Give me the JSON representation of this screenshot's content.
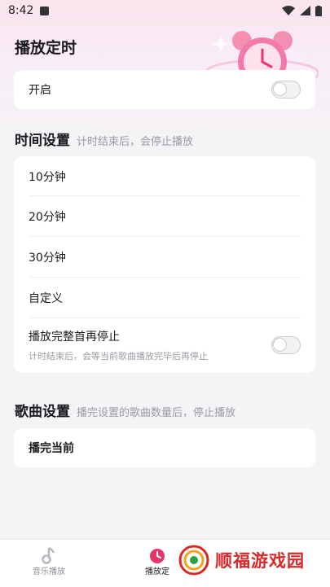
{
  "status_bar": {
    "time": "8:42"
  },
  "page_title": "播放定时",
  "enable": {
    "label": "开启"
  },
  "time_section": {
    "title": "时间设置",
    "subtitle": "计时结束后，会停止播放",
    "options": [
      "10分钟",
      "20分钟",
      "30分钟",
      "自定义"
    ],
    "full_play": {
      "label": "播放完整首再停止",
      "desc": "计时结束后，会等当前歌曲播放完毕后再停止"
    }
  },
  "song_section": {
    "title": "歌曲设置",
    "subtitle": "播完设置的歌曲数量后，停止播放",
    "option": "播完当前"
  },
  "bottom_nav": {
    "items": [
      {
        "label": "音乐播放"
      },
      {
        "label": "播放定"
      }
    ]
  },
  "watermark": {
    "text": "顺福游戏园"
  },
  "colors": {
    "accent": "#e8356b",
    "watermark": "#d62929"
  }
}
